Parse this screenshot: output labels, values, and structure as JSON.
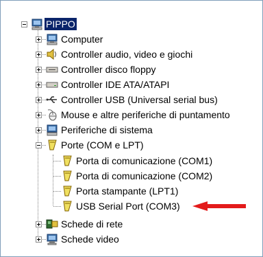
{
  "tree": {
    "root": {
      "label": "PIPPO",
      "expanded": true,
      "selected": true,
      "icon": "computer-icon"
    },
    "items": [
      {
        "label": "Computer",
        "toggle": "+",
        "icon": "computer-icon"
      },
      {
        "label": "Controller audio, video e giochi",
        "toggle": "+",
        "icon": "speaker-icon"
      },
      {
        "label": "Controller disco floppy",
        "toggle": "+",
        "icon": "floppy-drive-icon"
      },
      {
        "label": "Controller IDE ATA/ATAPI",
        "toggle": "+",
        "icon": "drive-icon"
      },
      {
        "label": "Controller USB (Universal serial bus)",
        "toggle": "+",
        "icon": "usb-icon"
      },
      {
        "label": "Mouse e altre periferiche di puntamento",
        "toggle": "+",
        "icon": "mouse-icon"
      },
      {
        "label": "Periferiche di sistema",
        "toggle": "+",
        "icon": "system-device-icon"
      },
      {
        "label": "Porte (COM e LPT)",
        "toggle": "-",
        "icon": "port-connector-icon",
        "children": [
          {
            "label": "Porta di comunicazione (COM1)",
            "icon": "port-connector-icon"
          },
          {
            "label": "Porta di comunicazione (COM2)",
            "icon": "port-connector-icon"
          },
          {
            "label": "Porta stampante (LPT1)",
            "icon": "port-connector-icon"
          },
          {
            "label": "USB Serial Port (COM3)",
            "icon": "port-connector-icon"
          }
        ]
      },
      {
        "label": "Schede di rete",
        "toggle": "+",
        "icon": "network-card-icon"
      },
      {
        "label": "Schede video",
        "toggle": "+",
        "icon": "display-adapter-icon"
      }
    ]
  },
  "annotation": {
    "icon": "red-arrow-icon",
    "color": "#e31b1b"
  },
  "colors": {
    "selection": "#0a246a",
    "tree_lines": "#808080"
  }
}
